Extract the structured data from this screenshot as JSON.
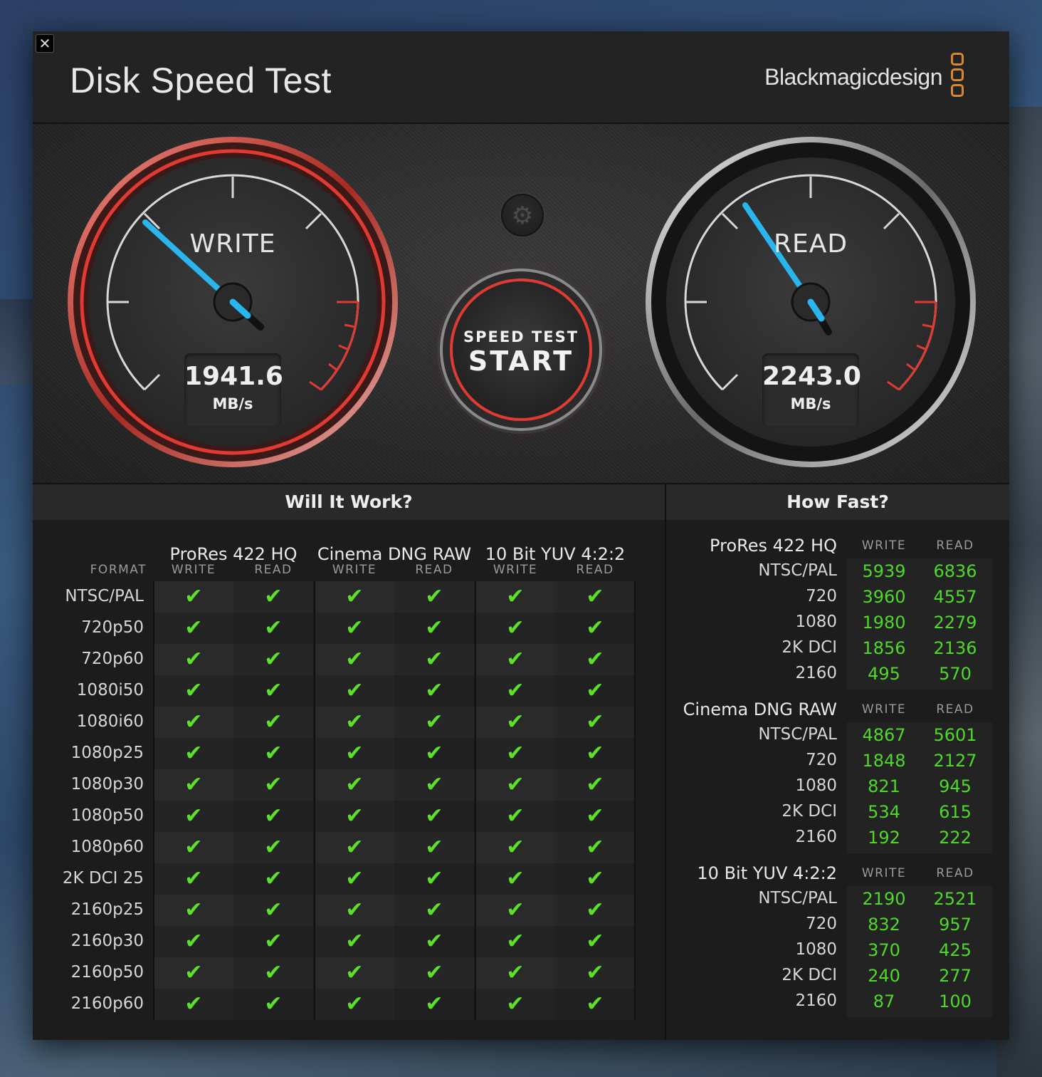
{
  "window": {
    "title": "Disk Speed Test",
    "brand": "Blackmagicdesign",
    "close_icon": "close-icon",
    "brand_accent": "#d9892c"
  },
  "write_gauge": {
    "label": "WRITE",
    "value": "1941.6",
    "unit": "MB/s",
    "accent": "#e03a32",
    "needle_color": "#29b6ee"
  },
  "read_gauge": {
    "label": "READ",
    "value": "2243.0",
    "unit": "MB/s",
    "needle_color": "#29b6ee"
  },
  "start_button": {
    "top": "SPEED TEST",
    "main": "START"
  },
  "settings_icon": "gear-icon",
  "will_it_work": {
    "title": "Will It Work?",
    "format_header": "FORMAT",
    "groups": [
      "ProRes 422 HQ",
      "Cinema DNG RAW",
      "10 Bit YUV 4:2:2"
    ],
    "subheaders": [
      "WRITE",
      "READ"
    ],
    "check_icon": "check-icon",
    "check_color": "#5de02a",
    "formats": [
      "NTSC/PAL",
      "720p50",
      "720p60",
      "1080i50",
      "1080i60",
      "1080p25",
      "1080p30",
      "1080p50",
      "1080p60",
      "2K DCI 25",
      "2160p25",
      "2160p30",
      "2160p50",
      "2160p60"
    ]
  },
  "how_fast": {
    "title": "How Fast?",
    "write_header": "WRITE",
    "read_header": "READ",
    "value_color": "#4fd82a",
    "groups": [
      {
        "name": "ProRes 422 HQ",
        "rows": [
          {
            "label": "NTSC/PAL",
            "write": "5939",
            "read": "6836"
          },
          {
            "label": "720",
            "write": "3960",
            "read": "4557"
          },
          {
            "label": "1080",
            "write": "1980",
            "read": "2279"
          },
          {
            "label": "2K DCI",
            "write": "1856",
            "read": "2136"
          },
          {
            "label": "2160",
            "write": "495",
            "read": "570"
          }
        ]
      },
      {
        "name": "Cinema DNG RAW",
        "rows": [
          {
            "label": "NTSC/PAL",
            "write": "4867",
            "read": "5601"
          },
          {
            "label": "720",
            "write": "1848",
            "read": "2127"
          },
          {
            "label": "1080",
            "write": "821",
            "read": "945"
          },
          {
            "label": "2K DCI",
            "write": "534",
            "read": "615"
          },
          {
            "label": "2160",
            "write": "192",
            "read": "222"
          }
        ]
      },
      {
        "name": "10 Bit YUV 4:2:2",
        "rows": [
          {
            "label": "NTSC/PAL",
            "write": "2190",
            "read": "2521"
          },
          {
            "label": "720",
            "write": "832",
            "read": "957"
          },
          {
            "label": "1080",
            "write": "370",
            "read": "425"
          },
          {
            "label": "2K DCI",
            "write": "240",
            "read": "277"
          },
          {
            "label": "2160",
            "write": "87",
            "read": "100"
          }
        ]
      }
    ]
  }
}
